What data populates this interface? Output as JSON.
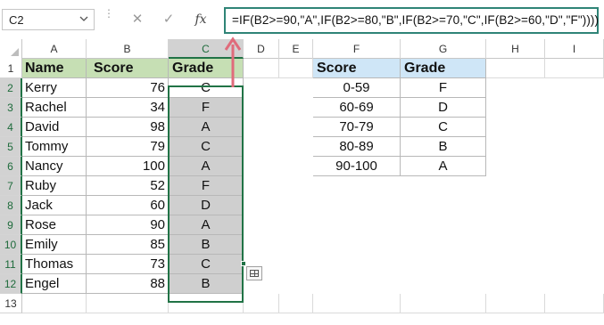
{
  "formula_bar": {
    "name_box": "C2",
    "cancel_icon": "close-icon",
    "enter_icon": "check-icon",
    "fx_label": "fx",
    "formula": "=IF(B2>=90,\"A\",IF(B2>=80,\"B\",IF(B2>=70,\"C\",IF(B2>=60,\"D\",\"F\"))))"
  },
  "columns": [
    "A",
    "B",
    "C",
    "D",
    "E",
    "F",
    "G",
    "H",
    "I"
  ],
  "selected_column": "C",
  "rows": [
    "1",
    "2",
    "3",
    "4",
    "5",
    "6",
    "7",
    "8",
    "9",
    "10",
    "11",
    "12",
    "13"
  ],
  "main_table": {
    "headers": {
      "name": "Name",
      "score": "Score",
      "grade": "Grade"
    },
    "records": [
      {
        "name": "Kerry",
        "score": "76",
        "grade": "C"
      },
      {
        "name": "Rachel",
        "score": "34",
        "grade": "F"
      },
      {
        "name": "David",
        "score": "98",
        "grade": "A"
      },
      {
        "name": "Tommy",
        "score": "79",
        "grade": "C"
      },
      {
        "name": "Nancy",
        "score": "100",
        "grade": "A"
      },
      {
        "name": "Ruby",
        "score": "52",
        "grade": "F"
      },
      {
        "name": "Jack",
        "score": "60",
        "grade": "D"
      },
      {
        "name": "Rose",
        "score": "90",
        "grade": "A"
      },
      {
        "name": "Emily",
        "score": "85",
        "grade": "B"
      },
      {
        "name": "Thomas",
        "score": "73",
        "grade": "C"
      },
      {
        "name": "Engel",
        "score": "88",
        "grade": "B"
      }
    ]
  },
  "lookup_table": {
    "headers": {
      "score": "Score",
      "grade": "Grade"
    },
    "records": [
      {
        "score": "0-59",
        "grade": "F"
      },
      {
        "score": "60-69",
        "grade": "D"
      },
      {
        "score": "70-79",
        "grade": "C"
      },
      {
        "score": "80-89",
        "grade": "B"
      },
      {
        "score": "90-100",
        "grade": "A"
      }
    ]
  },
  "colors": {
    "header_green": "#c6dfb4",
    "header_blue": "#cfe6f7",
    "selection_green": "#217346",
    "formula_border": "#2f8477",
    "arrow": "#e06b7b"
  }
}
